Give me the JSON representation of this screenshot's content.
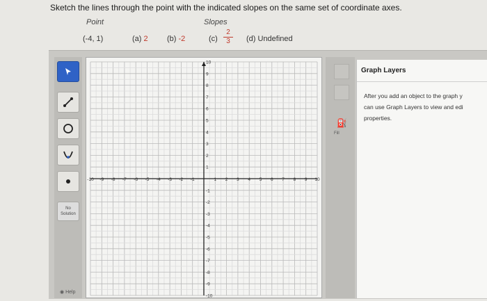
{
  "question": {
    "instruction": "Sketch the lines through the point with the indicated slopes on the same set of coordinate axes.",
    "point_header": "Point",
    "slopes_header": "Slopes",
    "point_value": "(-4, 1)",
    "slope_a_label": "(a)",
    "slope_a_value": "2",
    "slope_b_label": "(b)",
    "slope_b_value": "-2",
    "slope_c_label": "(c)",
    "slope_c_numerator": "2",
    "slope_c_denominator": "3",
    "slope_d": "(d) Undefined"
  },
  "toolbar": {
    "tools": [
      "pointer",
      "line",
      "circle",
      "parabola",
      "point"
    ],
    "no_solution_line1": "No",
    "no_solution_line2": "Solution",
    "help_label": "Help"
  },
  "graph": {
    "x_min": -10,
    "x_max": 10,
    "y_min": -10,
    "y_max": 10,
    "x_ticks": [
      "-10",
      "-9",
      "-8",
      "-7",
      "-6",
      "-5",
      "-4",
      "-3",
      "-2",
      "-1",
      "1",
      "2",
      "3",
      "4",
      "5",
      "6",
      "7",
      "8",
      "9",
      "10"
    ],
    "y_ticks": [
      "10",
      "9",
      "8",
      "7",
      "6",
      "5",
      "4",
      "3",
      "2",
      "1",
      "-1",
      "-2",
      "-3",
      "-4",
      "-5",
      "-6",
      "-7",
      "-8",
      "-9",
      "-10"
    ]
  },
  "right_strip": {
    "fill_label": "Fill"
  },
  "panel": {
    "title": "Graph Layers",
    "body_line1": "After you add an object to the graph y",
    "body_line2": "can use Graph Layers to view and edi",
    "body_line3": "properties."
  },
  "colors": {
    "accent": "#2f62c6",
    "slope_red": "#c0392b"
  }
}
